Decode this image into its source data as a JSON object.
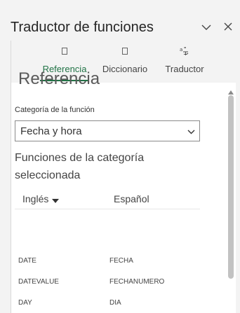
{
  "pane": {
    "title": "Traductor de funciones",
    "collapse_icon": "chevron-down-icon",
    "close_icon": "close-icon"
  },
  "tabs": [
    {
      "label": "Referencia",
      "icon": "book-icon",
      "selected": true
    },
    {
      "label": "Diccionario",
      "icon": "dictionary-icon",
      "selected": false
    },
    {
      "label": "Traductor",
      "icon": "translate-icon",
      "selected": false
    }
  ],
  "reference": {
    "title": "Referencia",
    "category_label": "Categoría de la función",
    "category_value": "Fecha y hora",
    "functions_heading": "Funciones de la categoría seleccionada",
    "col_english": "Inglés",
    "col_spanish": "Español",
    "rows": [
      {
        "en": "DATE",
        "es": "FECHA"
      },
      {
        "en": "DATEVALUE",
        "es": "FECHANUMERO"
      },
      {
        "en": "DAY",
        "es": "DIA"
      }
    ]
  },
  "colors": {
    "accent": "#217346",
    "pane_bg": "#f3f3f3",
    "text": "#252525"
  }
}
